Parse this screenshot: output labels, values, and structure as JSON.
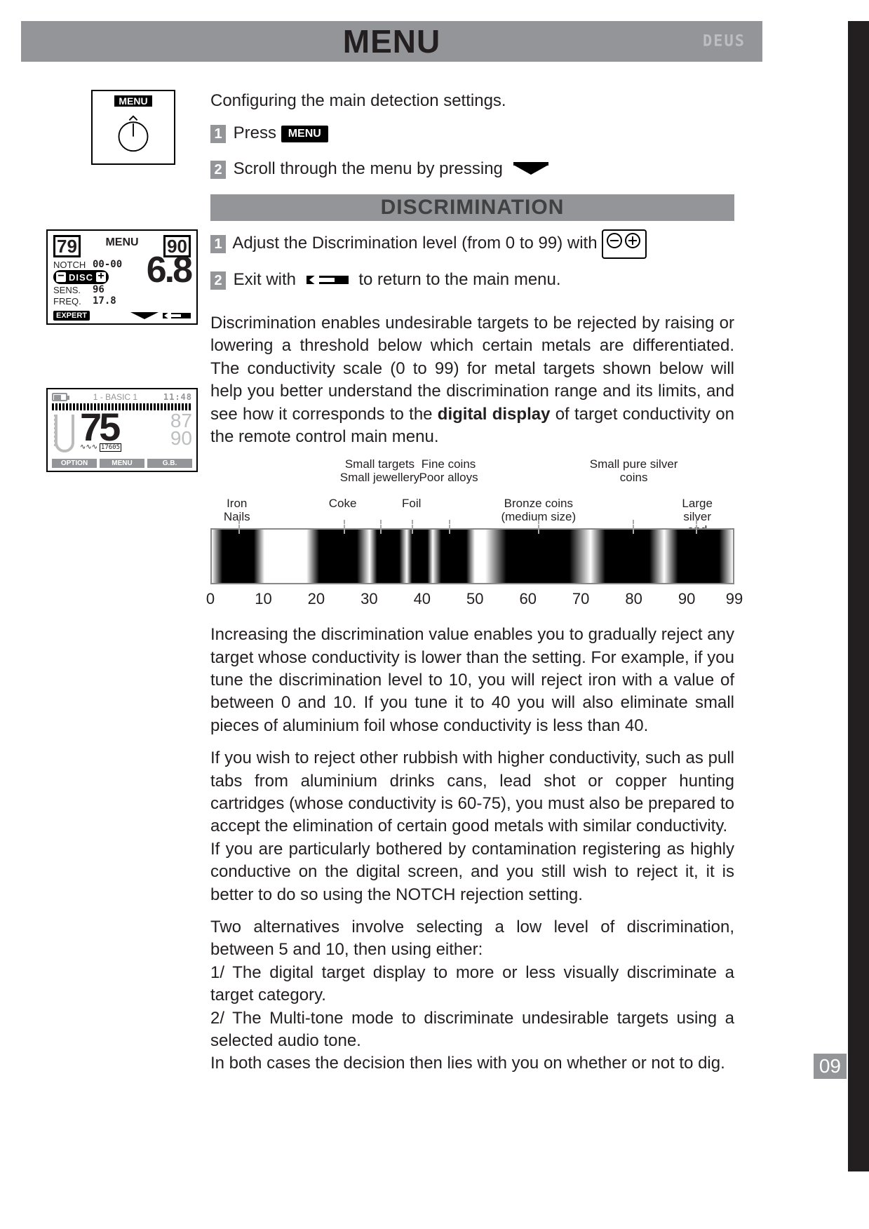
{
  "page": {
    "title": "MENU",
    "brand": "DEUS",
    "number": "09"
  },
  "intro": {
    "menu_label": "MENU",
    "line": "Configuring the main detection settings.",
    "step1_prefix": "Press",
    "step1_button": "MENU",
    "step2": "Scroll through the menu by pressing"
  },
  "section": {
    "heading": "DISCRIMINATION",
    "step1_a": "Adjust the Discrimination level (from 0 to 99) with",
    "step2_a": "Exit with",
    "step2_b": "to return to the main menu."
  },
  "device_menu": {
    "top_left": "79",
    "title": "MENU",
    "top_right": "90",
    "big": "6.8",
    "rows": {
      "notch_label": "NOTCH",
      "notch_val": "00-00",
      "disc_label": "DISC",
      "sens_label": "SENS.",
      "sens_val": "96",
      "freq_label": "FREQ.",
      "freq_val": "17.8"
    },
    "expert": "EXPERT"
  },
  "device_main": {
    "program": "1 - BASIC   1",
    "clock": "11:48",
    "big": "75",
    "ghost_a": "87",
    "ghost_b": "90",
    "small": "17605",
    "buttons": {
      "option": "OPTION",
      "menu": "MENU",
      "gb": "G.B."
    }
  },
  "body": {
    "p1": "Discrimination enables undesirable targets to be rejected by raising or lowering a threshold below which certain metals are differentiated. The conductivity scale (0 to 99) for metal targets shown below will help you better understand the discrimination range and its limits, and see how it corresponds to the ",
    "p1_bold": "digital display",
    "p1_tail": " of target conductivity on the remote control main menu.",
    "p2": "Increasing the discrimination value enables you to gradually reject any target whose conductivity is lower than the setting. For example, if you tune the discrimination level to 10, you will reject iron with a value of between 0 and 10. If you tune it to 40 you will also eliminate small pieces of aluminium foil whose conductivity is less than 40.",
    "p3": "If you wish to reject other rubbish with higher conductivity, such as pull tabs from aluminium drinks cans, lead shot or copper hunting cartridges (whose conductivity is 60-75), you must also be prepared to accept the elimination of certain good metals with similar conductivity.",
    "p4": "If you are particularly bothered by contamination registering as highly conductive on the digital screen, and you still wish to reject it, it is better to do so using the NOTCH rejection setting.",
    "p5": "Two alternatives involve selecting a low level of discrimination, between 5 and 10, then using either:",
    "p6": "1/ The digital target display to more or less visually discriminate a target category.",
    "p7": "2/ The Multi-tone mode to discriminate undesirable targets using a selected audio tone.",
    "p8": "In both cases the decision then lies with you on whether or not to dig."
  },
  "chart_data": {
    "type": "bar",
    "xlim": [
      0,
      99
    ],
    "ticks": [
      0,
      10,
      20,
      30,
      40,
      50,
      60,
      70,
      80,
      90,
      99
    ],
    "upper_labels": [
      {
        "text": "Small targets\nSmall jewellery",
        "x": 32
      },
      {
        "text": "Fine coins\nPoor alloys",
        "x": 45
      },
      {
        "text": "Small pure silver coins",
        "x": 80
      }
    ],
    "lower_labels": [
      {
        "text": "Iron\nNails",
        "x": 5
      },
      {
        "text": "Coke",
        "x": 25
      },
      {
        "text": "Foil",
        "x": 38
      },
      {
        "text": "Bronze coins\n(medium size)",
        "x": 62
      },
      {
        "text": "Large silver and\ncopper coins",
        "x": 92
      }
    ],
    "bands": [
      {
        "start": 0,
        "end": 10
      },
      {
        "start": 18,
        "end": 30
      },
      {
        "start": 30,
        "end": 37
      },
      {
        "start": 37,
        "end": 42
      },
      {
        "start": 42,
        "end": 50
      },
      {
        "start": 52,
        "end": 72
      },
      {
        "start": 72,
        "end": 86
      },
      {
        "start": 86,
        "end": 99
      }
    ]
  }
}
